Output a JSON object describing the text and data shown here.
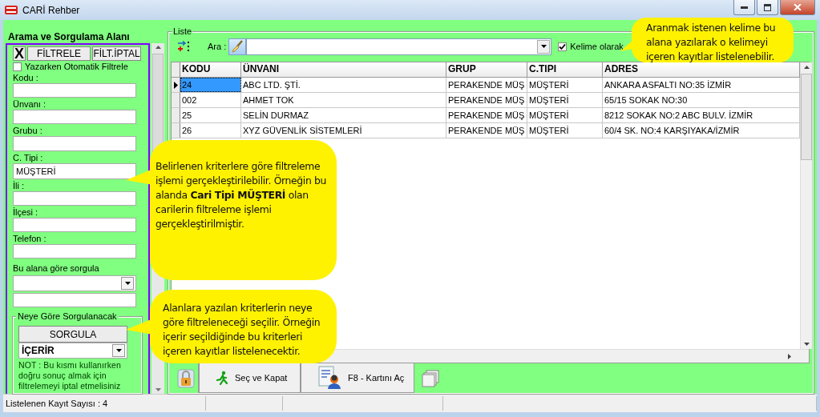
{
  "window": {
    "title": "CARİ Rehber"
  },
  "search_panel": {
    "title": "Arama ve Sorgulama Alanı",
    "clear_button": "X",
    "filter_button": "FİLTRELE",
    "cancel_filter_button": "FİLT.İPTAL",
    "auto_filter": {
      "label": "Yazarken Otomatik Filtrele",
      "checked": false
    },
    "fields": [
      {
        "label": "Kodu :"
      },
      {
        "label": "Ünvanı :"
      },
      {
        "label": "Grubu :"
      },
      {
        "label": "C. Tipi :",
        "value": "MÜŞTERİ"
      },
      {
        "label": "İli :"
      },
      {
        "label": "İlçesi :"
      },
      {
        "label": "Telefon :"
      }
    ],
    "query_field": {
      "label": "Bu alana göre sorgula"
    },
    "query_group": {
      "title": "Neye Göre Sorgulanacak",
      "button": "SORGULA",
      "mode": "İÇERİR",
      "note": "NOT : Bu kısmı kullanırken doğru sonuç almak için filtrelemeyi iptal etmelisiniz"
    }
  },
  "list": {
    "title": "Liste",
    "search_label": "Ara :",
    "whole_word": {
      "label": "Kelime olarak",
      "checked": true
    },
    "columns": [
      "KODU",
      "ÜNVANI",
      "GRUP",
      "C.TIPI",
      "ADRES"
    ],
    "rows": [
      {
        "cells": [
          "24",
          "ABC LTD. ŞTİ.",
          "PERAKENDE MÜŞ",
          "MÜŞTERİ",
          "ANKARA ASFALTI NO:35  İZMİR"
        ],
        "selected": true
      },
      {
        "cells": [
          "002",
          "AHMET TOK",
          "PERAKENDE MÜŞ",
          "MÜŞTERİ",
          "65/15 SOKAK NO:30"
        ],
        "selected": false
      },
      {
        "cells": [
          "25",
          "SELİN DURMAZ",
          "PERAKENDE MÜŞ",
          "MÜŞTERİ",
          "8212 SOKAK NO:2 ABC BULV. İZMİR"
        ],
        "selected": false
      },
      {
        "cells": [
          "26",
          "XYZ GÜVENLİK SİSTEMLERİ",
          "PERAKENDE MÜŞ",
          "MÜŞTERİ",
          "60/4 SK. NO:4 KARŞIYAKA/İZMİR"
        ],
        "selected": false
      }
    ],
    "buttons": [
      {
        "kind": "select",
        "label": "Seç ve Kapat"
      },
      {
        "kind": "card",
        "label": "F8 - Kartını Aç"
      }
    ]
  },
  "callouts": [
    {
      "text": "Belirlenen kriterlere göre filtreleme işlemi gerçekleştirilebilir. Örneğin bu alanda **Cari Tipi MÜŞTERİ** olan carilerin filtreleme işlemi gerçekleştirilmiştir."
    },
    {
      "text": "Alanlara yazılan kriterlerin neye göre filtreleneceği seçilir. Örneğin içerir seçildiğinde bu kriterleri içeren kayıtlar listelenecektir."
    },
    {
      "text": "Aranmak istenen kelime bu alana yazılarak o kelimeyi içeren kayıtlar listelenebilir."
    }
  ],
  "status_bar": {
    "text": "Listelenen Kayıt Sayısı : 4"
  }
}
